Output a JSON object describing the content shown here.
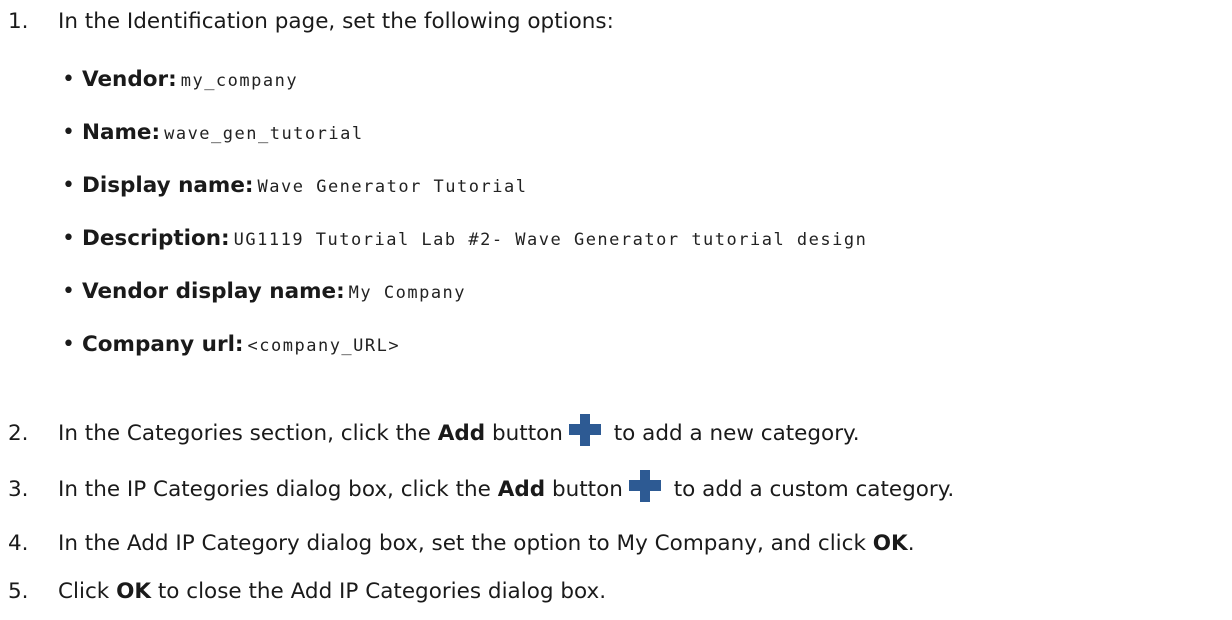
{
  "steps": [
    {
      "num": "1.",
      "text": "In the Identification page, set the following options:"
    },
    {
      "num": "2.",
      "pre": "In the Categories section, click the ",
      "bold": "Add",
      "mid": " button",
      "post": " to add a new category."
    },
    {
      "num": "3.",
      "pre": "In the IP Categories dialog box, click the ",
      "bold": "Add",
      "mid": " button",
      "post": " to add a custom category."
    },
    {
      "num": "4.",
      "pre": "In the Add IP Category dialog box, set the option to My Company, and click ",
      "bold": "OK",
      "post": "."
    },
    {
      "num": "5.",
      "pre": "Click ",
      "bold": "OK",
      "post": " to close the Add IP Categories dialog box."
    }
  ],
  "options": [
    {
      "label": "Vendor:",
      "value": "my_company"
    },
    {
      "label": "Name:",
      "value": "wave_gen_tutorial"
    },
    {
      "label": "Display name:",
      "value": "Wave Generator Tutorial"
    },
    {
      "label": "Description:",
      "value": "UG1119 Tutorial Lab #2- Wave Generator tutorial design"
    },
    {
      "label": "Vendor display name:",
      "value": "My Company"
    },
    {
      "label": "Company url:",
      "value": "<company_URL>"
    }
  ],
  "bullet_glyph": "•",
  "icons": {
    "add": "plus-icon",
    "add_color": "#2d5a93"
  }
}
